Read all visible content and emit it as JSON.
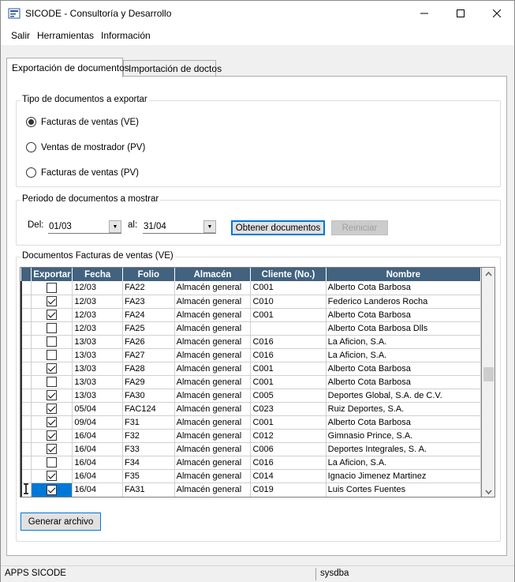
{
  "window": {
    "title": "SICODE - Consultoría y Desarrollo"
  },
  "menu": {
    "items": [
      "Salir",
      "Herramientas",
      "Información"
    ]
  },
  "tabs": [
    {
      "label": "Exportación de documentos",
      "active": true
    },
    {
      "label": "Importación de doctos",
      "active": false
    }
  ],
  "tipo": {
    "title": "Tipo de documentos a exportar",
    "options": [
      {
        "label": "Facturas de ventas (VE)",
        "selected": true
      },
      {
        "label": "Ventas de mostrador (PV)",
        "selected": false
      },
      {
        "label": "Facturas de ventas (PV)",
        "selected": false
      }
    ]
  },
  "periodo": {
    "title": "Periodo de documentos a mostrar",
    "del_label": "Del:",
    "del_value": "01/03",
    "al_label": "al:",
    "al_value": "31/04",
    "obtener_label": "Obtener documentos",
    "reiniciar_label": "Reiniciar"
  },
  "documentos": {
    "title": "Documentos Facturas de ventas (VE)",
    "columns": [
      "Exportar",
      "Fecha",
      "Folio",
      "Almacén",
      "Cliente (No.)",
      "Nombre"
    ],
    "rows": [
      {
        "exportar": false,
        "fecha": "12/03",
        "folio": "FA22",
        "almacen": "Almacén general",
        "cliente": "C001",
        "nombre": "Alberto Cota Barbosa"
      },
      {
        "exportar": true,
        "fecha": "12/03",
        "folio": "FA23",
        "almacen": "Almacén general",
        "cliente": "C010",
        "nombre": "Federico Landeros Rocha"
      },
      {
        "exportar": true,
        "fecha": "12/03",
        "folio": "FA24",
        "almacen": "Almacén general",
        "cliente": "C001",
        "nombre": "Alberto Cota Barbosa"
      },
      {
        "exportar": false,
        "fecha": "12/03",
        "folio": "FA25",
        "almacen": "Almacén general",
        "cliente": "",
        "nombre": "Alberto Cota Barbosa Dlls"
      },
      {
        "exportar": false,
        "fecha": "13/03",
        "folio": "FA26",
        "almacen": "Almacén general",
        "cliente": "C016",
        "nombre": "La Aficion, S.A."
      },
      {
        "exportar": false,
        "fecha": "13/03",
        "folio": "FA27",
        "almacen": "Almacén general",
        "cliente": "C016",
        "nombre": "La Aficion, S.A."
      },
      {
        "exportar": true,
        "fecha": "13/03",
        "folio": "FA28",
        "almacen": "Almacén general",
        "cliente": "C001",
        "nombre": "Alberto Cota Barbosa"
      },
      {
        "exportar": false,
        "fecha": "13/03",
        "folio": "FA29",
        "almacen": "Almacén general",
        "cliente": "C001",
        "nombre": "Alberto Cota Barbosa"
      },
      {
        "exportar": true,
        "fecha": "13/03",
        "folio": "FA30",
        "almacen": "Almacén general",
        "cliente": "C005",
        "nombre": "Deportes Global, S.A. de C.V."
      },
      {
        "exportar": true,
        "fecha": "05/04",
        "folio": "FAC124",
        "almacen": "Almacén general",
        "cliente": "C023",
        "nombre": "Ruiz Deportes, S.A."
      },
      {
        "exportar": true,
        "fecha": "09/04",
        "folio": "F31",
        "almacen": "Almacén general",
        "cliente": "C001",
        "nombre": "Alberto Cota Barbosa"
      },
      {
        "exportar": true,
        "fecha": "16/04",
        "folio": "F32",
        "almacen": "Almacén general",
        "cliente": "C012",
        "nombre": "Gimnasio Prince, S.A."
      },
      {
        "exportar": true,
        "fecha": "16/04",
        "folio": "F33",
        "almacen": "Almacén general",
        "cliente": "C006",
        "nombre": "Deportes Integrales, S. A."
      },
      {
        "exportar": false,
        "fecha": "16/04",
        "folio": "F34",
        "almacen": "Almacén general",
        "cliente": "C016",
        "nombre": "La Aficion, S.A."
      },
      {
        "exportar": true,
        "fecha": "16/04",
        "folio": "F35",
        "almacen": "Almacén general",
        "cliente": "C014",
        "nombre": "Ignacio Jimenez Martinez"
      },
      {
        "exportar": true,
        "fecha": "16/04",
        "folio": "FA31",
        "almacen": "Almacén general",
        "cliente": "C019",
        "nombre": "Luis Cortes Fuentes",
        "selected": true
      }
    ]
  },
  "generar_label": "Generar archivo",
  "status": {
    "left": "APPS SICODE",
    "right": "sysdba"
  }
}
